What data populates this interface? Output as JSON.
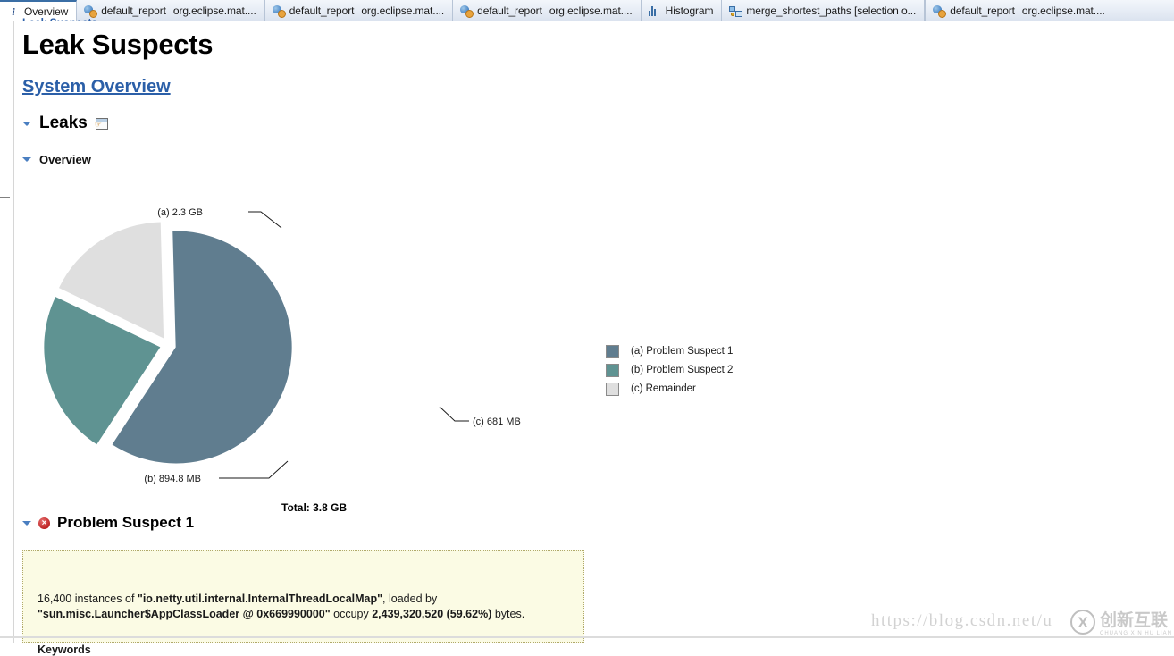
{
  "tabs": [
    {
      "icon": "info-icon",
      "label": "Overview",
      "sub": "",
      "active": true
    },
    {
      "icon": "report-icon",
      "label": "default_report",
      "sub": "org.eclipse.mat....",
      "active": false
    },
    {
      "icon": "report-icon",
      "label": "default_report",
      "sub": "org.eclipse.mat....",
      "active": false
    },
    {
      "icon": "report-icon",
      "label": "default_report",
      "sub": "org.eclipse.mat....",
      "active": false
    },
    {
      "icon": "histogram-icon",
      "label": "Histogram",
      "sub": "",
      "active": false
    },
    {
      "icon": "merge-icon",
      "label": "merge_shortest_paths [selection o...",
      "sub": "",
      "active": false
    },
    {
      "icon": "report-icon",
      "label": "default_report",
      "sub": "org.eclipse.mat....",
      "active": false
    }
  ],
  "breadcrumb": {
    "label": "Leak Suspects"
  },
  "page": {
    "title": "Leak Suspects",
    "system_overview_link": "System Overview",
    "leaks_section": "Leaks",
    "overview_section": "Overview"
  },
  "chart_data": {
    "type": "pie",
    "title": "",
    "total_label": "Total: 3.8 GB",
    "legend_position": "right",
    "slices": [
      {
        "key": "(a)",
        "name": "Problem Suspect 1",
        "label": "(a)  2.3 GB",
        "value": 2439320520,
        "display": "2.3 GB",
        "percent": 59.62,
        "color": "#607d8f"
      },
      {
        "key": "(b)",
        "name": "Problem Suspect 2",
        "label": "(b)  894.8 MB",
        "value": 938284748,
        "display": "894.8 MB",
        "percent": 22.93,
        "color": "#5f9392"
      },
      {
        "key": "(c)",
        "name": "Remainder",
        "label": "(c)  681 MB",
        "value": 714080256,
        "display": "681 MB",
        "percent": 17.45,
        "color": "#dfdfdf"
      }
    ],
    "legend": [
      {
        "label": "(a)  Problem Suspect 1",
        "color": "#607d8f"
      },
      {
        "label": "(b)  Problem Suspect 2",
        "color": "#5f9392"
      },
      {
        "label": "(c)  Remainder",
        "color": "#dfdfdf"
      }
    ]
  },
  "problem_suspect": {
    "heading": "Problem Suspect 1",
    "error_glyph": "×",
    "description_html": "16,400 instances of <b>\"io.netty.util.internal.InternalThreadLocalMap\"</b>, loaded by <b>\"sun.misc.Launcher$AppClassLoader @ 0x669990000\"</b> occupy <b>2,439,320,520 (59.62%)</b> bytes.",
    "keywords_heading": "Keywords"
  },
  "watermark": {
    "url": "https://blog.csdn.net/u",
    "brand": "创新互联",
    "brand_sub": "CHUANG XIN HU LIAN",
    "mark": "X"
  }
}
